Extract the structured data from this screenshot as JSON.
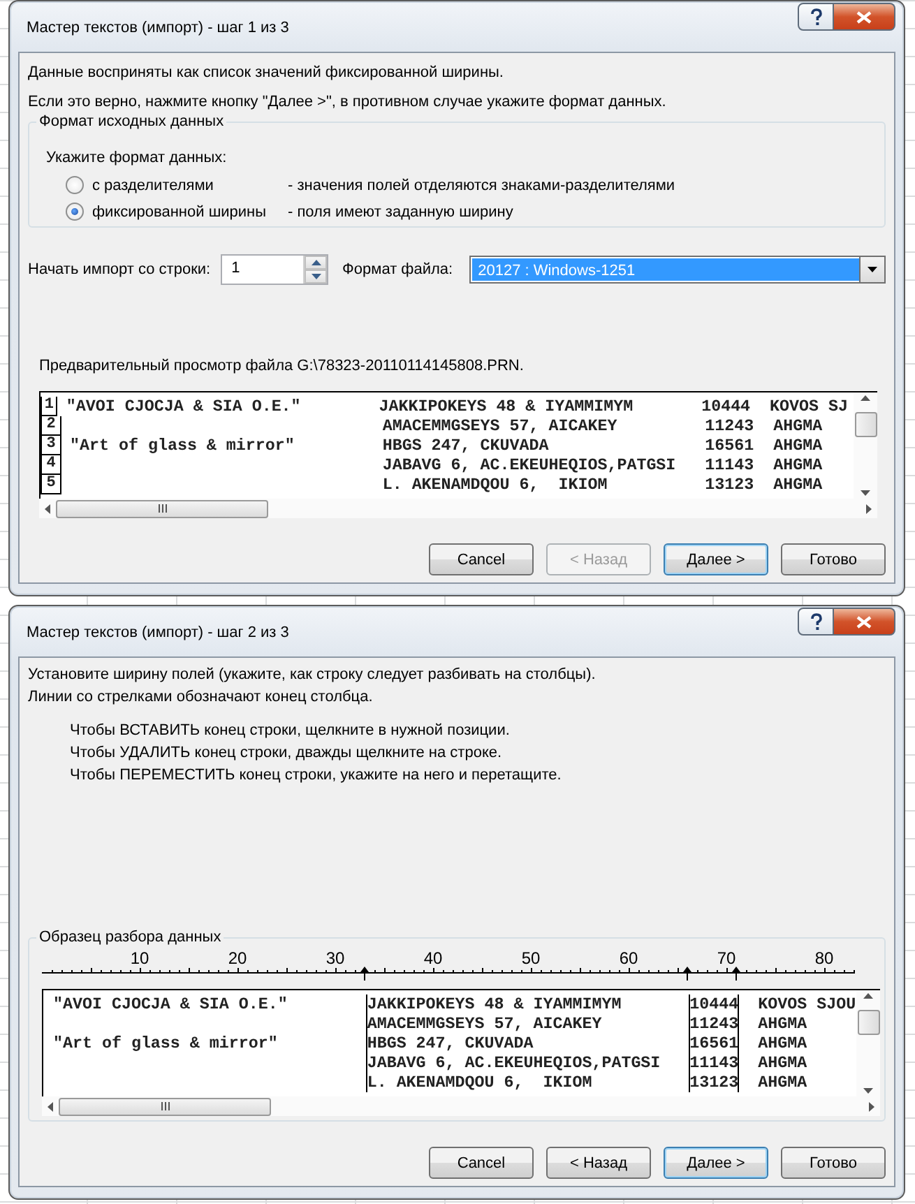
{
  "dialogs": [
    {
      "kind": "step1",
      "title": "Мастер текстов (импорт) - шаг 1 из 3",
      "intro": [
        "Данные восприняты как список значений фиксированной ширины.",
        "Если это верно, нажмите кнопку \"Далее >\", в противном случае укажите формат данных."
      ],
      "format_group": {
        "legend": "Формат исходных данных",
        "prompt": "Укажите формат данных:",
        "options": [
          {
            "label": "с разделителями",
            "description": "- значения полей отделяются знаками-разделителями",
            "selected": false
          },
          {
            "label": "фиксированной ширины",
            "description": "- поля имеют заданную ширину",
            "selected": true
          }
        ]
      },
      "start_row": {
        "label": "Начать импорт со строки:",
        "value": "1"
      },
      "file_format": {
        "label": "Формат файла:",
        "value": "20127 : Windows-1251"
      },
      "preview": {
        "caption": "Предварительный просмотр файла G:\\78323-20110114145808.PRN.",
        "rows": [
          {
            "number": "1",
            "column_1": "\"AVOI CJOCJA & SIA O.E.\"",
            "column_2": "JAKKIPOKEYS 48 & IYAMMIMYM",
            "column_3": "10444",
            "column_4": "KOVOS SJ"
          },
          {
            "number": "2",
            "column_2": "AMACEMMGSEYS 57, AICAKEY",
            "column_3": "11243",
            "column_4": "AHGMA"
          },
          {
            "number": "3",
            "column_1": "\"Art of glass & mirror\"",
            "column_2": "HBGS 247, CKUVADA",
            "column_3": "16561",
            "column_4": "AHGMA"
          },
          {
            "number": "4",
            "column_2": "JABAVG 6, AC.EKEUHEQIOS,PATGSI",
            "column_3": "11143",
            "column_4": "AHGMA"
          },
          {
            "number": "5",
            "column_2": "L. AKENAMDQOU 6,  IKIOM",
            "column_3": "13123",
            "column_4": "AHGMA"
          }
        ]
      },
      "buttons": [
        {
          "label": "Cancel",
          "disabled": false,
          "default": false
        },
        {
          "label": "< Назад",
          "disabled": true,
          "default": false
        },
        {
          "label": "Далее >",
          "disabled": false,
          "default": true
        },
        {
          "label": "Готово",
          "disabled": false,
          "default": false
        }
      ]
    },
    {
      "kind": "step2",
      "title": "Мастер текстов (импорт) - шаг 2 из 3",
      "intro": [
        "Установите ширину полей (укажите, как строку следует разбивать на столбцы).",
        "Линии со стрелками обозначают конец столбца."
      ],
      "hints": [
        "Чтобы ВСТАВИТЬ конец строки, щелкните в нужной позиции.",
        "Чтобы УДАЛИТЬ конец строки, дважды щелкните на строке.",
        "Чтобы ПЕРЕМЕСТИТЬ конец строки, укажите на него и перетащите."
      ],
      "preview": {
        "legend": "Образец разбора данных",
        "ruler": [
          "10",
          "20",
          "30",
          "40",
          "50",
          "60",
          "70",
          "80"
        ],
        "rows": [
          {
            "column_1": "\"AVOI CJOCJA & SIA O.E.\"",
            "column_2": "JAKKIPOKEYS 48 & IYAMMIMYM",
            "column_3": "10444",
            "column_4": "KOVOS SJOU"
          },
          {
            "column_2": "AMACEMMGSEYS 57, AICAKEY",
            "column_3": "11243",
            "column_4": "AHGMA"
          },
          {
            "column_1": "\"Art of glass & mirror\"",
            "column_2": "HBGS 247, CKUVADA",
            "column_3": "16561",
            "column_4": "AHGMA"
          },
          {
            "column_2": "JABAVG 6, AC.EKEUHEQIOS,PATGSI",
            "column_3": "11143",
            "column_4": "AHGMA"
          },
          {
            "column_2": "L. AKENAMDQOU 6,  IKIOM",
            "column_3": "13123",
            "column_4": "AHGMA"
          }
        ]
      },
      "buttons": [
        {
          "label": "Cancel",
          "disabled": false,
          "default": false
        },
        {
          "label": "< Назад",
          "disabled": false,
          "default": false
        },
        {
          "label": "Далее >",
          "disabled": false,
          "default": true
        },
        {
          "label": "Готово",
          "disabled": false,
          "default": false
        }
      ]
    }
  ]
}
